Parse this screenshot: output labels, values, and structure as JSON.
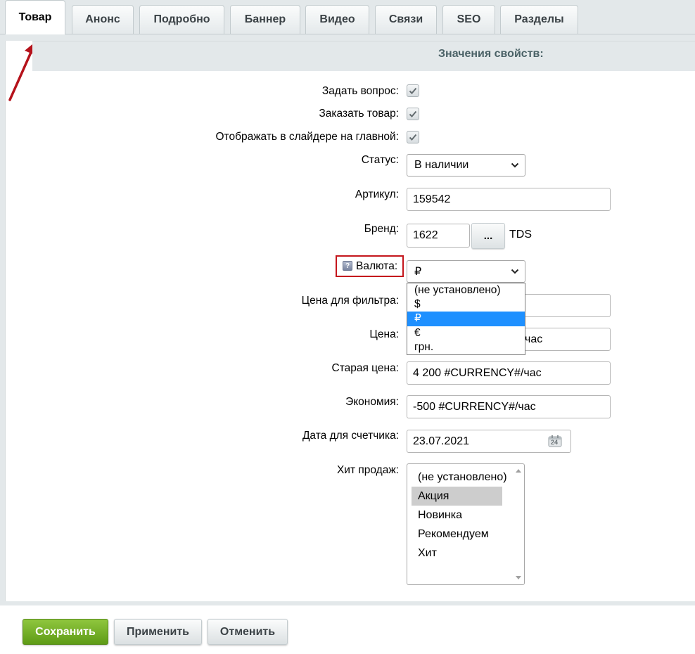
{
  "tabs": [
    {
      "label": "Товар",
      "active": true
    },
    {
      "label": "Анонс"
    },
    {
      "label": "Подробно"
    },
    {
      "label": "Баннер"
    },
    {
      "label": "Видео"
    },
    {
      "label": "Связи"
    },
    {
      "label": "SEO"
    },
    {
      "label": "Разделы"
    }
  ],
  "section_title": "Значения свойств:",
  "fields": {
    "ask_question": {
      "label": "Задать вопрос:",
      "checked": true
    },
    "order_item": {
      "label": "Заказать товар:",
      "checked": true
    },
    "show_in_slider": {
      "label": "Отображать в слайдере на главной:",
      "checked": true
    },
    "status": {
      "label": "Статус:",
      "value": "В наличии"
    },
    "article": {
      "label": "Артикул:",
      "value": "159542"
    },
    "brand": {
      "label": "Бренд:",
      "value": "1622",
      "browse_label": "...",
      "brand_name": "TDS"
    },
    "currency": {
      "label": "Валюта:",
      "help_icon": "?",
      "value": "₽",
      "options": [
        "(не установлено)",
        "$",
        "₽",
        "€",
        "грн."
      ],
      "selected_index": 2
    },
    "filter_price": {
      "label": "Цена для фильтра:",
      "value": ""
    },
    "price": {
      "label": "Цена:",
      "value_suffix": "час"
    },
    "old_price": {
      "label": "Старая цена:",
      "value": "4 200 #CURRENCY#/час"
    },
    "savings": {
      "label": "Экономия:",
      "value": "-500 #CURRENCY#/час"
    },
    "counter_date": {
      "label": "Дата для счетчика:",
      "value": "23.07.2021",
      "calendar_day": "24"
    },
    "bestseller": {
      "label": "Хит продаж:",
      "options": [
        "(не установлено)",
        "Акция",
        "Новинка",
        "Рекомендуем",
        "Хит"
      ],
      "highlighted_index": 1
    }
  },
  "buttons": {
    "save": "Сохранить",
    "apply": "Применить",
    "cancel": "Отменить"
  },
  "colors": {
    "save_green": "#7ab32e",
    "highlight_red": "#c4161c",
    "selected_blue": "#1e90ff"
  }
}
